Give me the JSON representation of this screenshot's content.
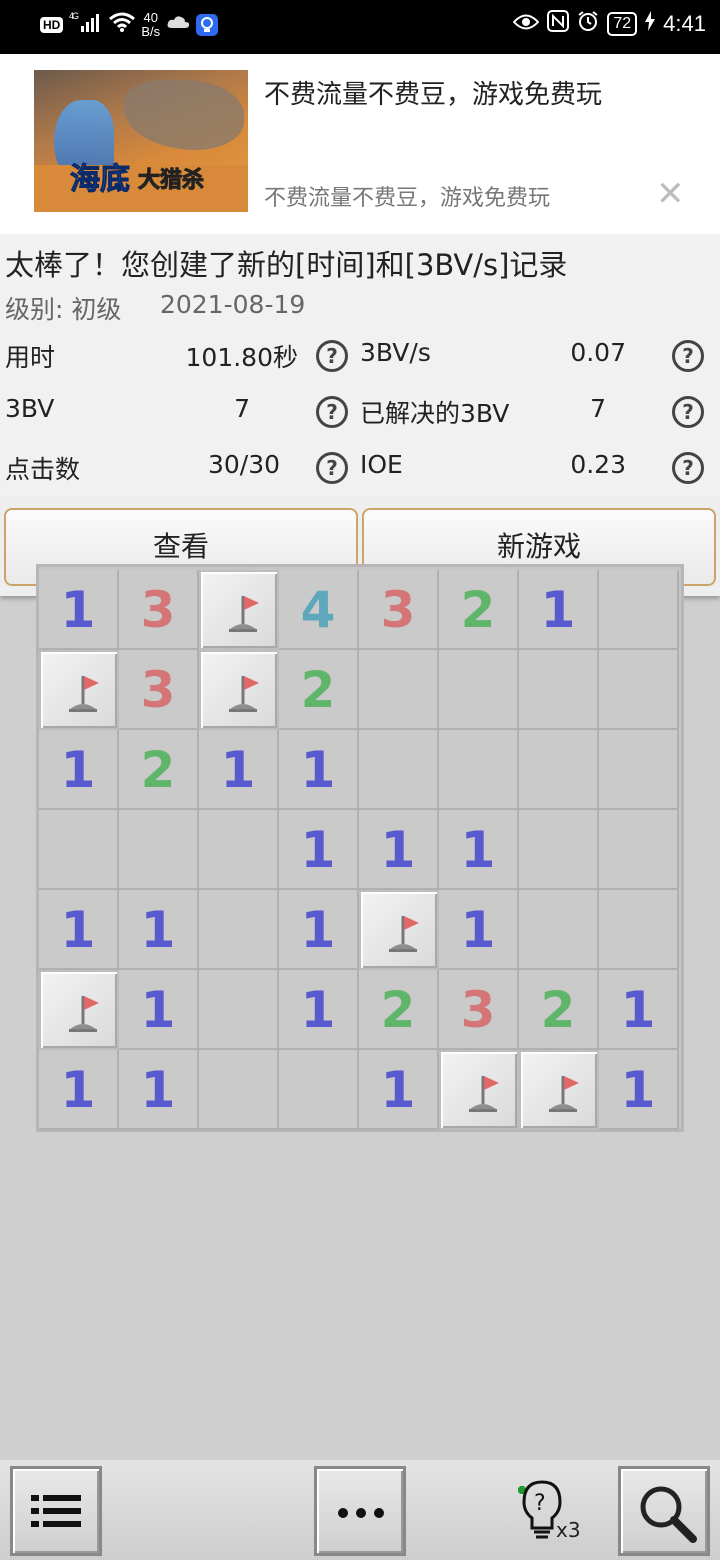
{
  "status_bar": {
    "hd": "HD",
    "network": "4G",
    "speed_value": "40",
    "speed_unit": "B/s",
    "battery": "72",
    "time": "4:41"
  },
  "ad": {
    "image_logo": "海底",
    "image_logo2": "大猎杀",
    "title": "不费流量不费豆，游戏免费玩",
    "subtitle": "不费流量不费豆，游戏免费玩",
    "close": "✕"
  },
  "result": {
    "title": "太棒了！您创建了新的[时间]和[3BV/s]记录",
    "level": "级别: 初级",
    "date": "2021-08-19",
    "stats_left": [
      {
        "label": "用时",
        "value": "101.80秒"
      },
      {
        "label": "3BV",
        "value": "7"
      },
      {
        "label": "点击数",
        "value": "30/30"
      }
    ],
    "stats_right": [
      {
        "label": "3BV/s",
        "value": "0.07"
      },
      {
        "label": "已解决的3BV",
        "value": "7"
      },
      {
        "label": "IOE",
        "value": "0.23"
      }
    ],
    "help_glyph": "?"
  },
  "actions": {
    "view": "查看",
    "new_game": "新游戏"
  },
  "board": {
    "rows": [
      [
        "1",
        "3",
        "F",
        "4",
        "3",
        "2",
        "1",
        ""
      ],
      [
        "F",
        "3",
        "F",
        "2",
        "",
        "",
        "",
        ""
      ],
      [
        "1",
        "2",
        "1",
        "1",
        "",
        "",
        "",
        ""
      ],
      [
        "",
        "",
        "",
        "1",
        "1",
        "1",
        "",
        ""
      ],
      [
        "1",
        "1",
        "",
        "1",
        "F",
        "1",
        "",
        ""
      ],
      [
        "F",
        "1",
        "",
        "1",
        "2",
        "3",
        "2",
        "1"
      ],
      [
        "1",
        "1",
        "",
        "",
        "1",
        "F",
        "F",
        "1"
      ]
    ]
  },
  "bottom_bar": {
    "hint_multiplier": "x3"
  }
}
